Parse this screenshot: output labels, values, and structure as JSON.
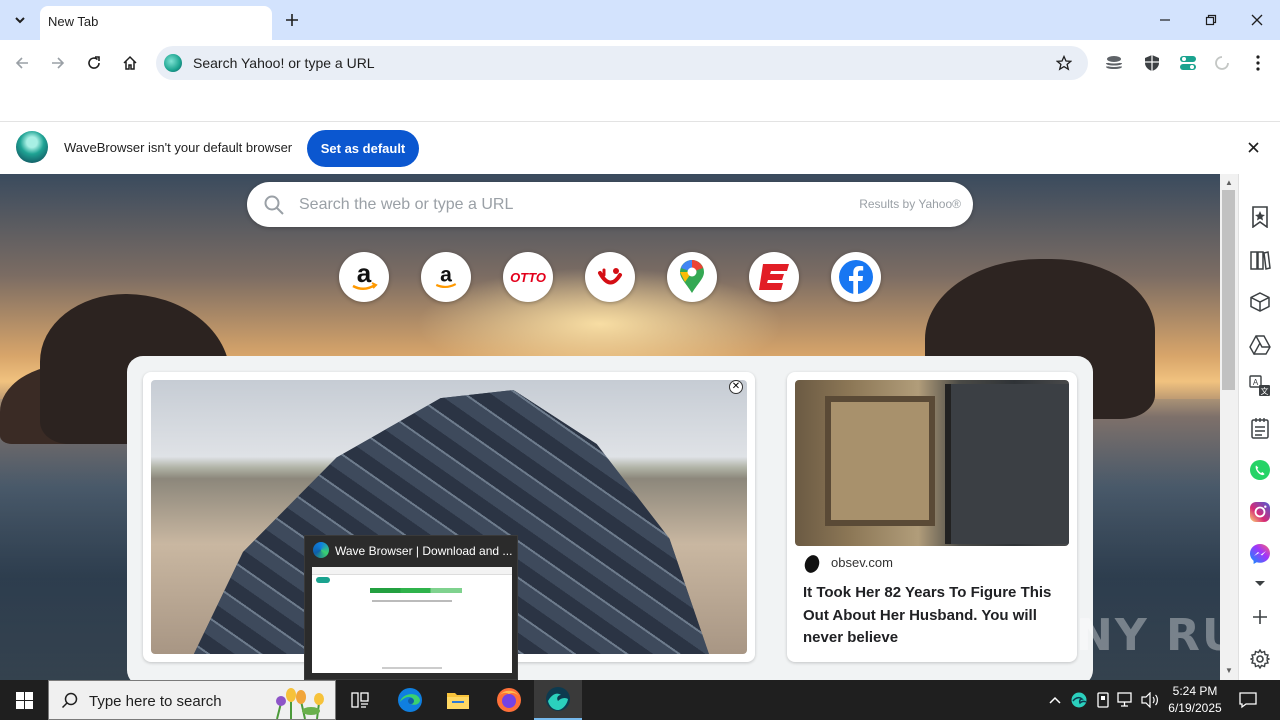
{
  "tab": {
    "title": "New Tab",
    "menu_icon": "chevron-down-icon",
    "new_tab_icon": "plus-icon"
  },
  "window_controls": {
    "minimize": "minimize-icon",
    "restore": "restore-icon",
    "close": "close-icon"
  },
  "toolbar": {
    "back_icon": "arrow-left-icon",
    "forward_icon": "arrow-right-icon",
    "reload_icon": "reload-icon",
    "home_icon": "home-icon",
    "omnibox_placeholder": "Search Yahoo! or type a URL",
    "bookmark_icon": "star-icon",
    "extensions": [
      "stack-icon",
      "shield-icon",
      "toggle-icon",
      "loading-icon",
      "kebab-menu-icon"
    ]
  },
  "infobar": {
    "message": "WaveBrowser isn't your default browser",
    "button": "Set as default",
    "close_icon": "close-icon"
  },
  "newtab": {
    "search_placeholder": "Search the web or type a URL",
    "results_by": "Results by Yahoo®",
    "shortcuts": [
      {
        "name": "amazon",
        "label": "a",
        "color": "#000000"
      },
      {
        "name": "amazon-alt",
        "label": "a",
        "color": "#000000"
      },
      {
        "name": "otto",
        "label": "OTTO",
        "color": "#e3001b"
      },
      {
        "name": "tui",
        "label": "tui-smile",
        "color": "#d40e14"
      },
      {
        "name": "google-maps",
        "label": "maps-pin",
        "color": "#34a853"
      },
      {
        "name": "espn",
        "label": "E",
        "color": "#e21e26"
      },
      {
        "name": "facebook",
        "label": "f",
        "color": "#1877f2"
      }
    ],
    "side_card": {
      "source": "obsev.com",
      "title": "It Took Her 82 Years To Figure This Out About Her Husband. You will never believe"
    }
  },
  "sidebar": {
    "items": [
      "bookmark-icon",
      "book-icon",
      "cube-icon",
      "drive-icon",
      "translate-icon",
      "notes-icon",
      "whatsapp-icon",
      "instagram-icon",
      "messenger-icon",
      "chevron-down-icon",
      "plus-icon",
      "settings-icon"
    ]
  },
  "tab_preview": {
    "title": "Wave Browser | Download and ..."
  },
  "taskbar": {
    "search_placeholder": "Type here to search",
    "apps": [
      "task-view-icon",
      "edge-icon",
      "file-explorer-icon",
      "firefox-icon",
      "wavebrowser-icon"
    ],
    "time": "5:24 PM",
    "date": "6/19/2025"
  },
  "watermark": "ANY RUN"
}
